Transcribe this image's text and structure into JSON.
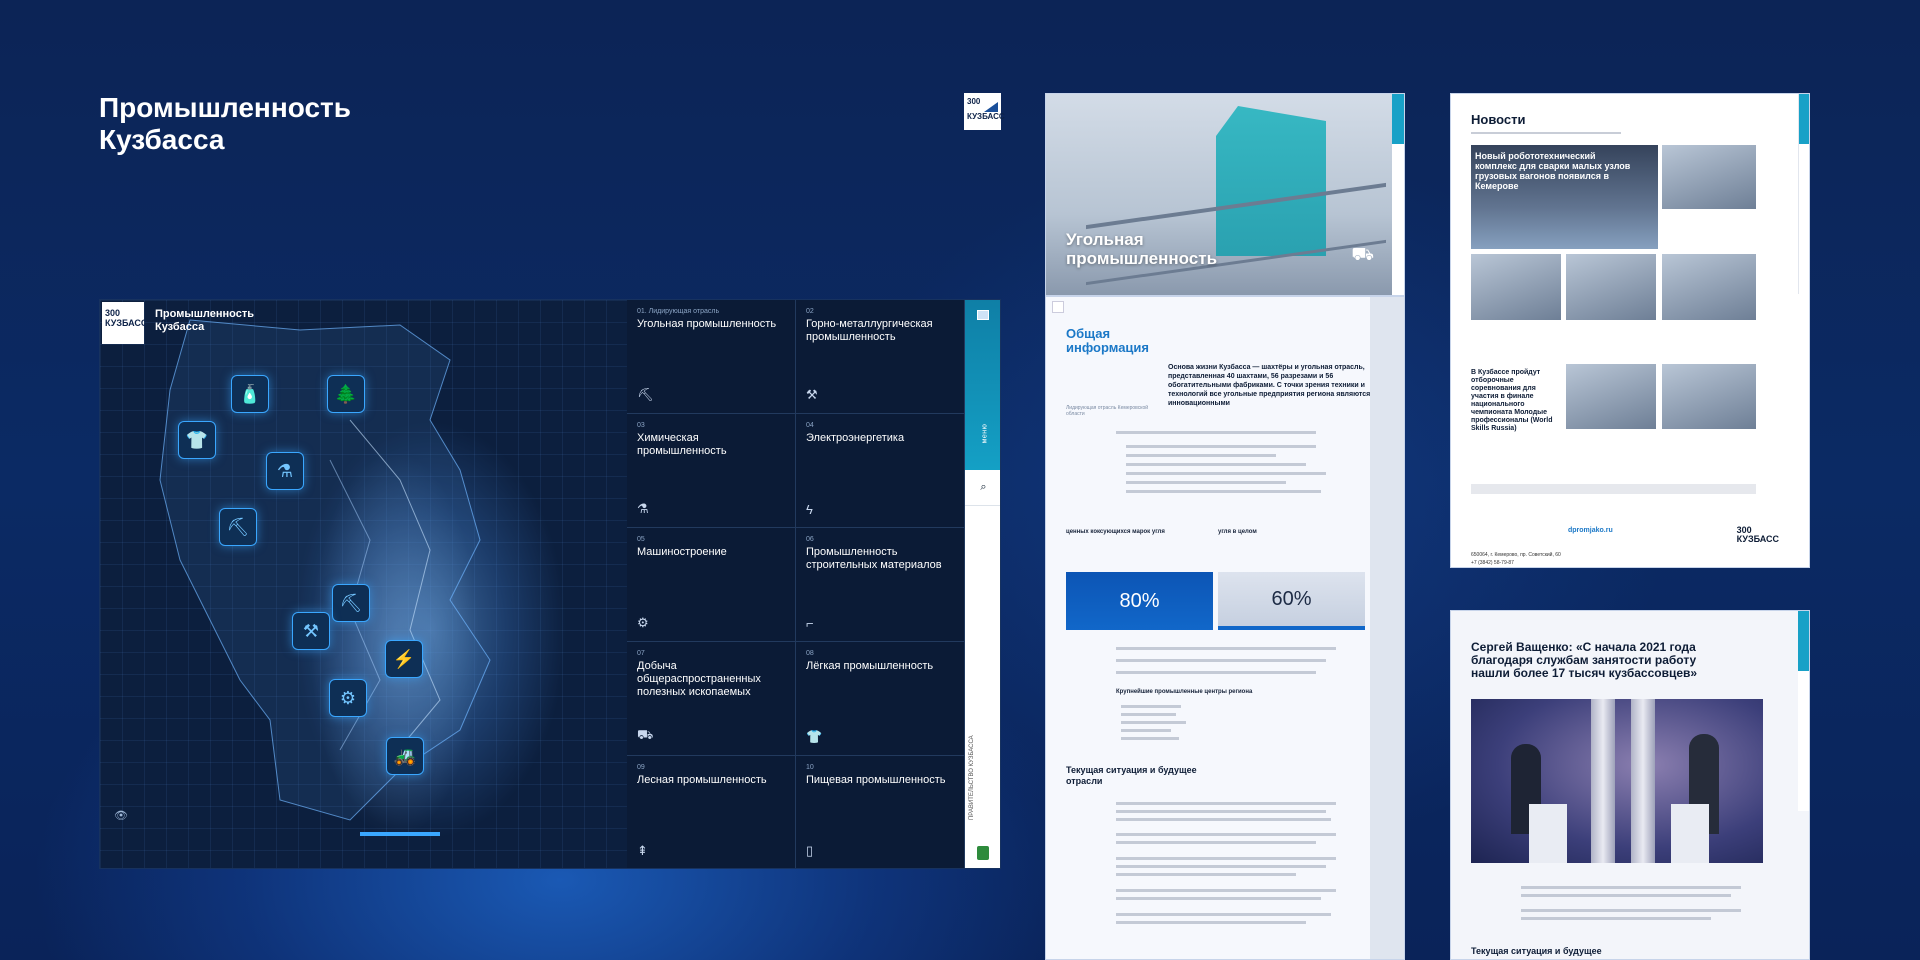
{
  "title": "Промышленность Кузбасса",
  "logo": {
    "top": "300",
    "bottom": "КУЗБАСС"
  },
  "main": {
    "header": "Промышленность Кузбасса",
    "menu_label": "меню",
    "gov_label": "ПРАВИТЕЛЬСТВО КУЗБАССА",
    "items": [
      {
        "num": "01. Лидирующая отрасль",
        "label": "Угольная промышленность",
        "icon": "coal-icon"
      },
      {
        "num": "02",
        "label": "Горно-металлургическая промышленность",
        "icon": "metal-icon"
      },
      {
        "num": "03",
        "label": "Химическая промышленность",
        "icon": "flask-icon"
      },
      {
        "num": "04",
        "label": "Электроэнергетика",
        "icon": "bolt-icon"
      },
      {
        "num": "05",
        "label": "Машиностроение",
        "icon": "gear-icon"
      },
      {
        "num": "06",
        "label": "Промышленность строительных материалов",
        "icon": "trowel-icon"
      },
      {
        "num": "07",
        "label": "Добыча общераспространенных полезных ископаемых",
        "icon": "excavator-icon"
      },
      {
        "num": "08",
        "label": "Лёгкая промышленность",
        "icon": "shirt-icon"
      },
      {
        "num": "09",
        "label": "Лесная промышленность",
        "icon": "tree-icon"
      },
      {
        "num": "10",
        "label": "Пищевая промышленность",
        "icon": "bottle-icon"
      }
    ]
  },
  "coal": {
    "title": "Угольная промышленность"
  },
  "info": {
    "heading": "Общая информация",
    "lead": "Основа жизни Кузбасса — шахтёры и угольная отрасль, представленная 40 шахтами, 56 разрезами и 56 обогатительными фабриками. С точки зрения техники и технологий все угольные предприятия региона являются инновационными",
    "sub": "Лидирующая отрасль Кемеровской области",
    "label1": "ценных коксующихся марок угля",
    "label2": "угля в целом",
    "value1": "80%",
    "value2": "60%",
    "centers": "Крупнейшие промышленные центры региона",
    "situation": "Текущая ситуация и будущее отрасли"
  },
  "news": {
    "heading": "Новости",
    "featured": "Новый робототехнический комплекс для сварки малых узлов грузовых вагонов появился в Кемерове",
    "worldskills": "В Кузбассе пройдут отборочные соревнования для участия в финале национального чемпионата Молодые профессионалы (World Skills Russia)",
    "link": "dpromjako.ru",
    "address": "650064, г. Кемерово, пр. Советский, 60",
    "phone": "+7 (3842) 58-79-87"
  },
  "article": {
    "title": "Сергей Ващенко: «С начала 2021 года благодаря службам занятости работу нашли более 17 тысяч кузбассовцев»",
    "h3": "Текущая ситуация и будущее"
  }
}
